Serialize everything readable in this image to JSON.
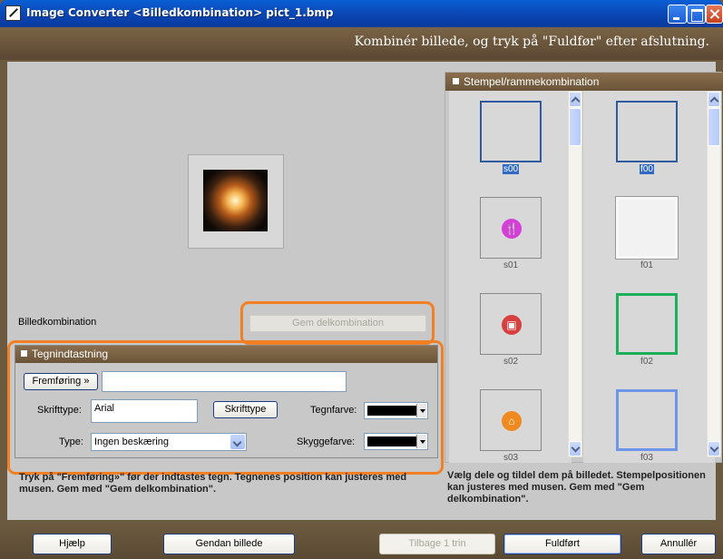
{
  "window": {
    "title": "Image Converter <Billedkombination> pict_1.bmp"
  },
  "header": {
    "instruction": "Kombinér billede, og tryk på \"Fuldfør\" efter afslutning."
  },
  "preview": {
    "section_label": "Billedkombination",
    "save_button": "Gem delkombination"
  },
  "text_panel": {
    "title": "Tegnindtastning",
    "advance_button": "Fremføring »",
    "text_value": "",
    "font_label": "Skrifttype:",
    "font_value": "Arial",
    "font_button": "Skrifttype",
    "color_label": "Tegnfarve:",
    "color_value": "#000000",
    "type_label": "Type:",
    "type_value": "Ingen beskæring",
    "shadow_label": "Skyggefarve:",
    "shadow_value": "#000000"
  },
  "help_left": "Tryk på \"Fremføring»\" før der indtastes tegn. Tegnenes position kan justeres med musen. Gem med \"Gem delkombination\".",
  "stamp_panel": {
    "title": "Stempel/rammekombination",
    "stamps": [
      {
        "label": "s00",
        "icon": "empty-icon",
        "selected": true
      },
      {
        "label": "s01",
        "icon": "fork-knife-icon",
        "color": "#d43fd8"
      },
      {
        "label": "s02",
        "icon": "fuel-pump-icon",
        "color": "#d84040"
      },
      {
        "label": "s03",
        "icon": "home-icon",
        "color": "#f08a20"
      }
    ],
    "frames": [
      {
        "label": "f00",
        "selected": true
      },
      {
        "label": "f01"
      },
      {
        "label": "f02",
        "color": "#1cb05a"
      },
      {
        "label": "f03",
        "color": "#6e95e8"
      }
    ]
  },
  "help_right": "Vælg dele og tildel dem på billedet. Stempelpositionen kan justeres med musen. Gem med \"Gem delkombination\".",
  "buttons": {
    "help": "Hjælp",
    "restore": "Gendan billede",
    "back": "Tilbage 1 trin",
    "finish": "Fuldført",
    "cancel": "Annullér"
  }
}
